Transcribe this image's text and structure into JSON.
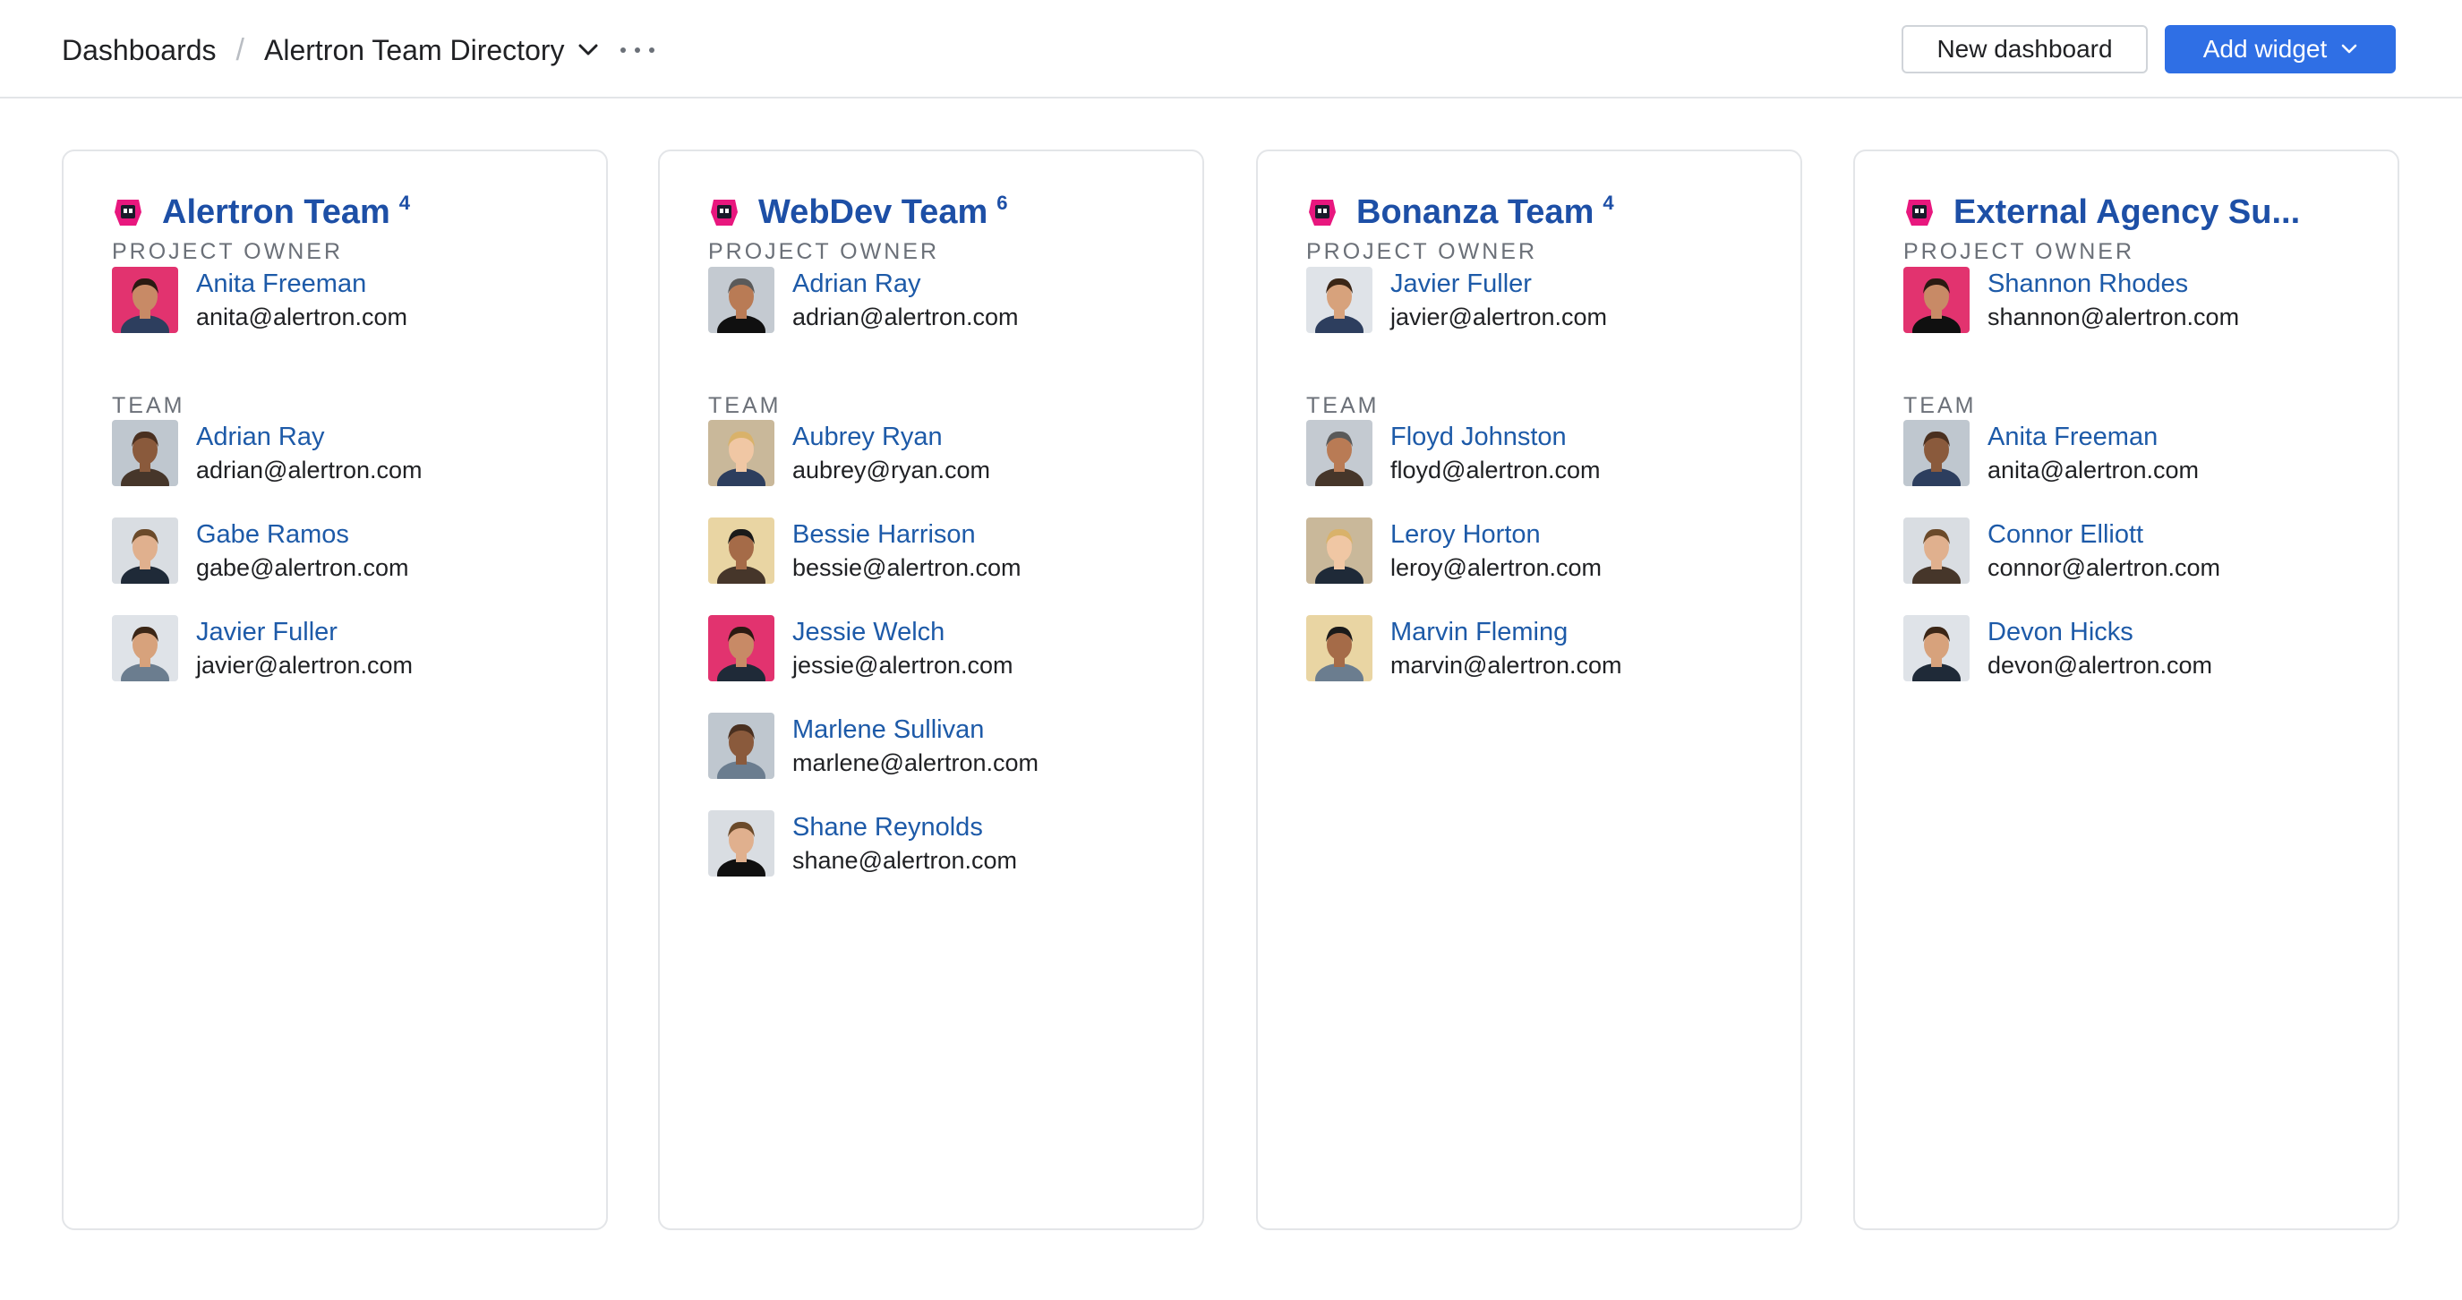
{
  "breadcrumb": {
    "root": "Dashboards",
    "separator": "/",
    "current": "Alertron Team Directory"
  },
  "actions": {
    "new_dashboard": "New dashboard",
    "add_widget": "Add widget"
  },
  "colors": {
    "accent": "#2f6fe5",
    "link": "#1d5aa8",
    "team_title": "#1d4fa6",
    "team_icon": "#e8177e"
  },
  "labels": {
    "owner": "PROJECT OWNER",
    "team": "TEAM"
  },
  "teams": [
    {
      "name": "Alertron Team",
      "count": "4",
      "owner": {
        "name": "Anita Freeman",
        "email": "anita@alertron.com"
      },
      "members": [
        {
          "name": "Adrian Ray",
          "email": "adrian@alertron.com"
        },
        {
          "name": "Gabe Ramos",
          "email": "gabe@alertron.com"
        },
        {
          "name": "Javier Fuller",
          "email": "javier@alertron.com"
        }
      ]
    },
    {
      "name": "WebDev Team",
      "count": "6",
      "owner": {
        "name": "Adrian Ray",
        "email": "adrian@alertron.com"
      },
      "members": [
        {
          "name": "Aubrey Ryan",
          "email": "aubrey@ryan.com"
        },
        {
          "name": "Bessie Harrison",
          "email": "bessie@alertron.com"
        },
        {
          "name": "Jessie Welch",
          "email": "jessie@alertron.com"
        },
        {
          "name": "Marlene Sullivan",
          "email": "marlene@alertron.com"
        },
        {
          "name": "Shane Reynolds",
          "email": "shane@alertron.com"
        }
      ]
    },
    {
      "name": "Bonanza Team",
      "count": "4",
      "owner": {
        "name": "Javier Fuller",
        "email": "javier@alertron.com"
      },
      "members": [
        {
          "name": "Floyd Johnston",
          "email": "floyd@alertron.com"
        },
        {
          "name": "Leroy Horton",
          "email": "leroy@alertron.com"
        },
        {
          "name": "Marvin Fleming",
          "email": "marvin@alertron.com"
        }
      ]
    },
    {
      "name": "External Agency Su...",
      "count": "",
      "owner": {
        "name": "Shannon Rhodes",
        "email": "shannon@alertron.com"
      },
      "members": [
        {
          "name": "Anita Freeman",
          "email": "anita@alertron.com"
        },
        {
          "name": "Connor Elliott",
          "email": "connor@alertron.com"
        },
        {
          "name": "Devon Hicks",
          "email": "devon@alertron.com"
        }
      ]
    }
  ]
}
